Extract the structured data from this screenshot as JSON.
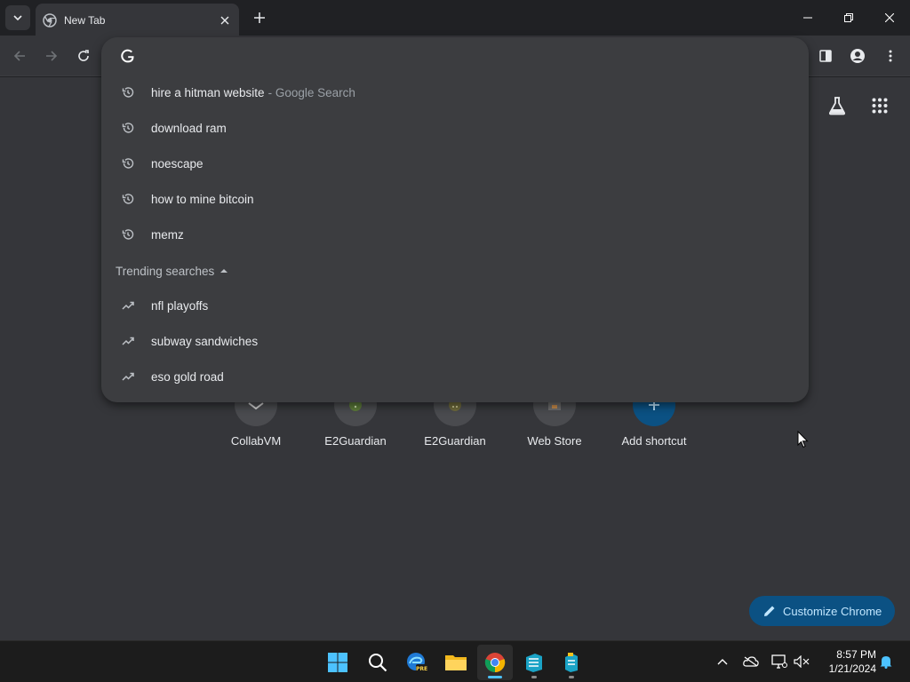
{
  "browser": {
    "tab": {
      "title": "New Tab"
    },
    "window_controls": [
      "minimize",
      "restore",
      "close"
    ]
  },
  "omnibox": {
    "input_value": "",
    "history_suggestions": [
      {
        "text": "hire a hitman website",
        "sub": "- Google Search",
        "icon": "history-icon"
      },
      {
        "text": "download ram",
        "sub": "",
        "icon": "history-icon"
      },
      {
        "text": "noescape",
        "sub": "",
        "icon": "history-icon"
      },
      {
        "text": "how to mine bitcoin",
        "sub": "",
        "icon": "history-icon"
      },
      {
        "text": "memz",
        "sub": "",
        "icon": "history-icon"
      }
    ],
    "trending_header": "Trending searches",
    "trending": [
      {
        "text": "nfl playoffs",
        "icon": "trending-icon"
      },
      {
        "text": "subway sandwiches",
        "icon": "trending-icon"
      },
      {
        "text": "eso gold road",
        "icon": "trending-icon"
      }
    ]
  },
  "new_tab_page": {
    "shortcuts": [
      {
        "label": "CollabVM"
      },
      {
        "label": "E2Guardian"
      },
      {
        "label": "E2Guardian"
      },
      {
        "label": "Web Store"
      },
      {
        "label": "Add shortcut"
      }
    ],
    "customize_label": "Customize Chrome"
  },
  "taskbar": {
    "apps": [
      "start-icon",
      "search-icon",
      "edge-beta-icon",
      "file-explorer-icon",
      "chrome-icon",
      "app-icon-1",
      "app-icon-2"
    ],
    "time": "8:57 PM",
    "date": "1/21/2024"
  },
  "colors": {
    "accent": "#0b5183",
    "accent_text": "#c2e7ff",
    "popup_bg": "#3c3d40"
  }
}
